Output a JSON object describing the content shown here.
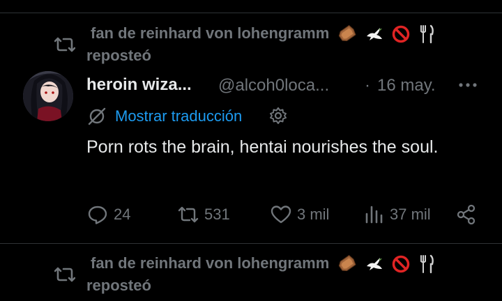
{
  "repost_1": {
    "name": "fan de reinhard von lohengramm",
    "verb": "reposteó"
  },
  "tweet": {
    "author": "heroin wiza...",
    "handle": "@alcoh0loca...",
    "separator": "·",
    "date": "16 may.",
    "translate_label": "Mostrar traducción",
    "text": "Porn rots the brain, hentai nourishes the soul.",
    "actions": {
      "replies": "24",
      "reposts": "531",
      "likes": "3 mil",
      "views": "37 mil"
    }
  },
  "repost_2": {
    "name": "fan de reinhard von lohengramm",
    "verb": "reposteó"
  },
  "colors": {
    "background": "#000000",
    "text_primary": "#e7e9ea",
    "text_secondary": "#71767b",
    "link": "#1d9bf0",
    "divider": "#2f3336"
  },
  "icons": [
    "repost-icon",
    "coffin-emoji",
    "dove-emoji",
    "prohibited-emoji",
    "fork-knife-emoji",
    "more-icon",
    "translate-icon",
    "gear-icon",
    "reply-icon",
    "retweet-icon",
    "like-icon",
    "views-icon",
    "share-icon"
  ]
}
